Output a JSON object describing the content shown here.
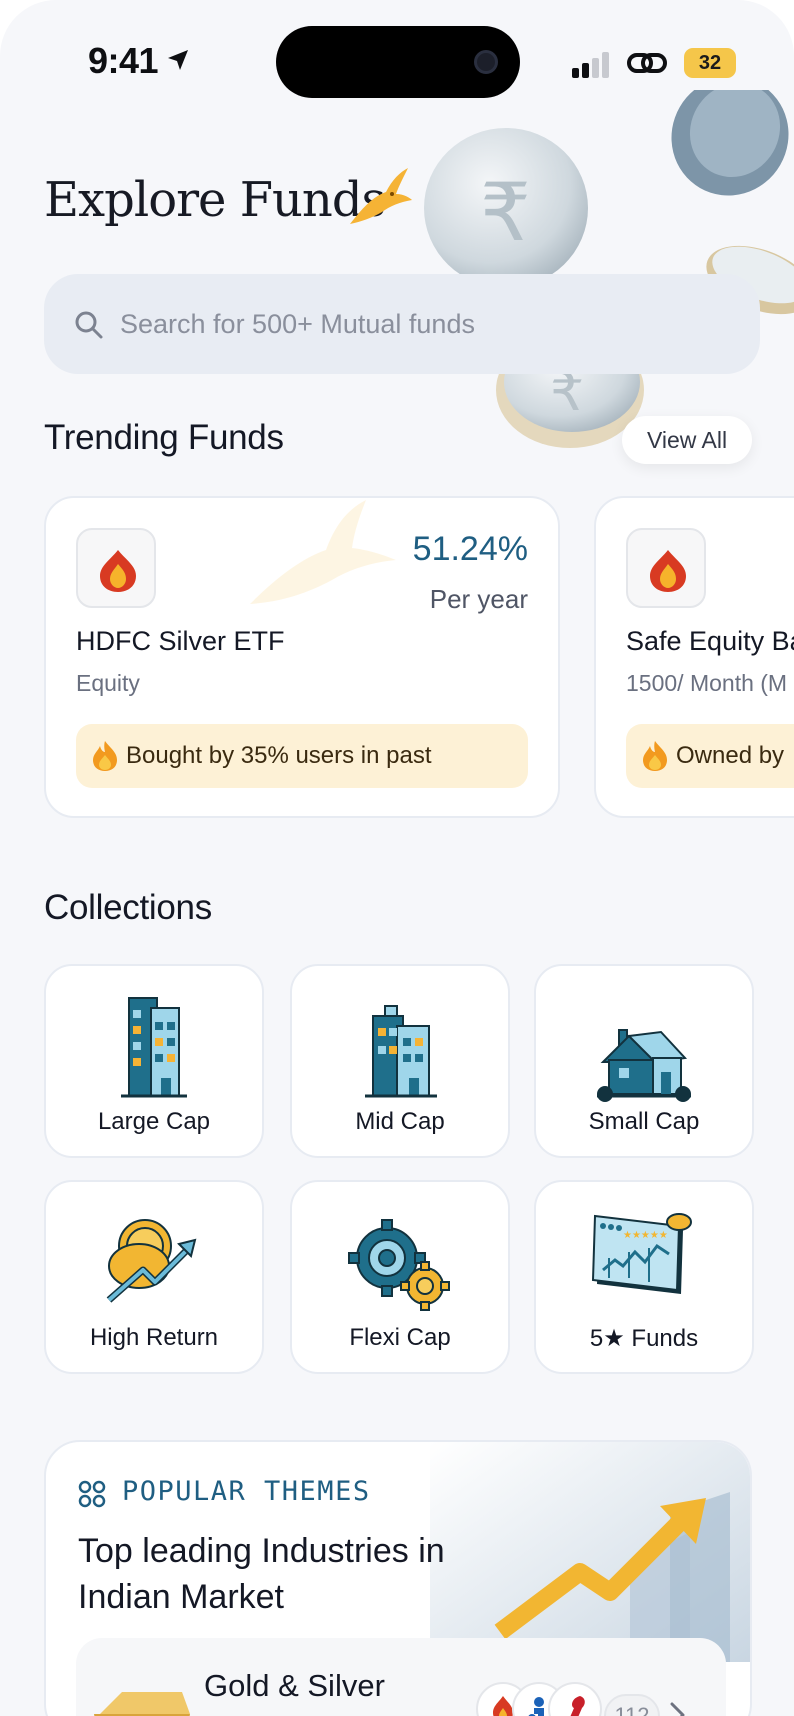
{
  "status_bar": {
    "time": "9:41",
    "battery": "32"
  },
  "header": {
    "title": "Explore Funds"
  },
  "search": {
    "placeholder": "Search for 500+ Mutual funds"
  },
  "trending": {
    "title": "Trending Funds",
    "view_all": "View All",
    "funds": [
      {
        "name": "HDFC Silver ETF",
        "category": "Equity",
        "return": "51.24%",
        "period": "Per year",
        "badge": "Bought by 35% users in past"
      },
      {
        "name": "Safe Equity Ba",
        "category": "1500/ Month (M",
        "badge": "Owned by"
      }
    ]
  },
  "collections": {
    "title": "Collections",
    "items": [
      {
        "label": "Large Cap",
        "icon": "large-building-icon"
      },
      {
        "label": "Mid Cap",
        "icon": "mid-building-icon"
      },
      {
        "label": "Small Cap",
        "icon": "house-icon"
      },
      {
        "label": "High Return",
        "icon": "coin-growth-icon"
      },
      {
        "label": "Flexi Cap",
        "icon": "gears-icon"
      },
      {
        "label": "5★ Funds",
        "icon": "rated-chart-icon"
      }
    ]
  },
  "themes": {
    "label": "POPULAR THEMES",
    "heading": "Top leading Industries in Indian Market",
    "items": [
      {
        "name": "Gold & Silver",
        "count": "112"
      }
    ]
  },
  "colors": {
    "accent": "#1f5e82",
    "badge_bg": "#fdf1d6",
    "page_bg": "#f6f7fa"
  }
}
